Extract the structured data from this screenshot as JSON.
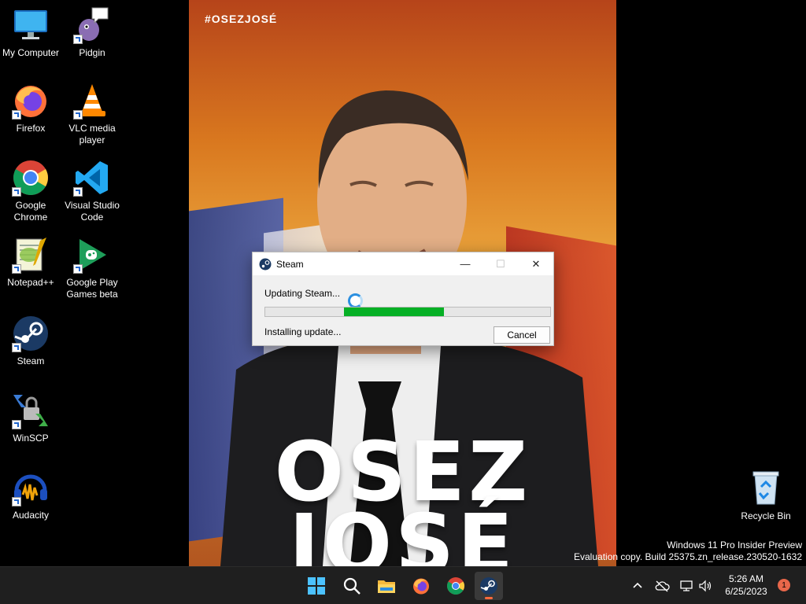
{
  "desktop": {
    "icons": [
      {
        "label": "My Computer",
        "icon": "computer-icon"
      },
      {
        "label": "Pidgin",
        "icon": "pidgin-icon"
      },
      {
        "label": "Firefox",
        "icon": "firefox-icon"
      },
      {
        "label": "VLC media player",
        "icon": "vlc-icon"
      },
      {
        "label": "Google Chrome",
        "icon": "chrome-icon"
      },
      {
        "label": "Visual Studio Code",
        "icon": "vscode-icon"
      },
      {
        "label": "Notepad++",
        "icon": "notepadpp-icon"
      },
      {
        "label": "Google Play Games beta",
        "icon": "google-play-games-icon"
      },
      {
        "label": "Steam",
        "icon": "steam-icon"
      },
      {
        "label": "WinSCP",
        "icon": "winscp-icon"
      },
      {
        "label": "Audacity",
        "icon": "audacity-icon"
      }
    ],
    "recycle_bin": {
      "label": "Recycle Bin",
      "icon": "recycle-bin-icon"
    }
  },
  "wallpaper": {
    "hashtag": "#OSEZJOSÉ",
    "line1": "OSEZ",
    "line2": "JOSÉ"
  },
  "steam_dialog": {
    "title": "Steam",
    "status": "Updating Steam...",
    "progress_fraction": 0.35,
    "detail": "Installing update...",
    "cancel_label": "Cancel",
    "minimize": "—",
    "maximize": "☐",
    "close": "✕"
  },
  "watermark": {
    "line1": "Windows 11 Pro Insider Preview",
    "line2": "Evaluation copy. Build 25375.zn_release.230520-1632"
  },
  "taskbar": {
    "apps": [
      "start-icon",
      "search-icon",
      "file-explorer-icon",
      "firefox-icon",
      "chrome-icon",
      "steam-icon"
    ],
    "active_app": "steam-icon",
    "time": "5:26 AM",
    "date": "6/25/2023",
    "notification_count": "1"
  },
  "colors": {
    "progress": "#06b025",
    "taskbar": "#1f1f1f",
    "steam_indicator": "#ff6a3d"
  }
}
